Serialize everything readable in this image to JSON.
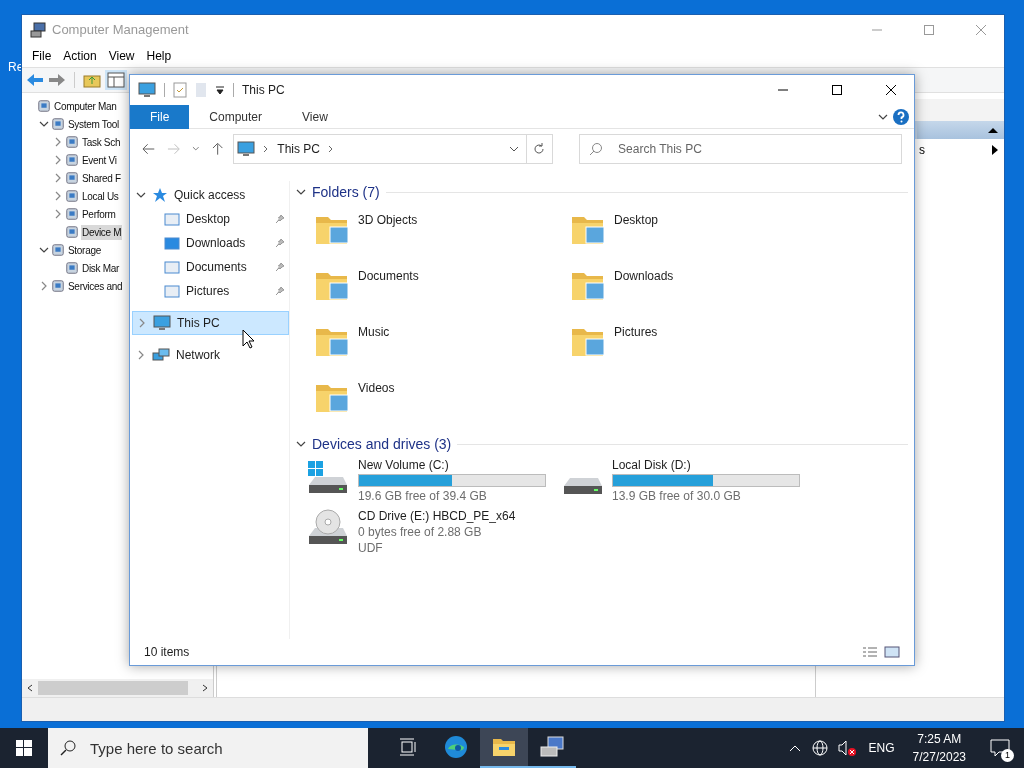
{
  "desktop": {
    "icon_label": "Re"
  },
  "mgmt_window": {
    "title": "Computer Management",
    "menu": [
      "File",
      "Action",
      "View",
      "Help"
    ],
    "tree": [
      {
        "label": "Computer Man",
        "selected": false,
        "children": [
          {
            "label": "System Tool",
            "expanded": true,
            "selected": false,
            "children": [
              {
                "label": "Task Sch",
                "expanded": false,
                "selected": false
              },
              {
                "label": "Event Vi",
                "expanded": false,
                "selected": false
              },
              {
                "label": "Shared F",
                "expanded": false,
                "selected": false
              },
              {
                "label": "Local Us",
                "expanded": false,
                "selected": false
              },
              {
                "label": "Perform",
                "expanded": false,
                "selected": false
              },
              {
                "label": "Device M",
                "selected": true
              }
            ]
          },
          {
            "label": "Storage",
            "expanded": true,
            "selected": false,
            "children": [
              {
                "label": "Disk Mar",
                "selected": false
              }
            ]
          },
          {
            "label": "Services and",
            "expanded": false,
            "selected": false
          }
        ]
      }
    ],
    "actions": {
      "item": "s"
    }
  },
  "explorer": {
    "title": "This PC",
    "ribbon_tabs": [
      {
        "label": "File",
        "selected": true
      },
      {
        "label": "Computer",
        "selected": false
      },
      {
        "label": "View",
        "selected": false
      }
    ],
    "address": "This PC",
    "search": {
      "placeholder": "Search This PC"
    },
    "nav": [
      {
        "label": "Quick access",
        "expanded": true,
        "selected": false,
        "children": [
          {
            "label": "Desktop",
            "pinned": true,
            "selected": false
          },
          {
            "label": "Downloads",
            "pinned": true,
            "selected": false
          },
          {
            "label": "Documents",
            "pinned": true,
            "selected": false
          },
          {
            "label": "Pictures",
            "pinned": true,
            "selected": false
          }
        ]
      },
      {
        "label": "This PC",
        "expanded": false,
        "selected": true
      },
      {
        "label": "Network",
        "expanded": false,
        "selected": false
      }
    ],
    "folders": {
      "title": "Folders (7)",
      "expanded": true,
      "items": [
        {
          "name": "3D Objects"
        },
        {
          "name": "Desktop"
        },
        {
          "name": "Documents"
        },
        {
          "name": "Downloads"
        },
        {
          "name": "Music"
        },
        {
          "name": "Pictures"
        },
        {
          "name": "Videos"
        }
      ]
    },
    "drives": {
      "title": "Devices and drives (3)",
      "expanded": true,
      "items": [
        {
          "kind": "system",
          "name": "New Volume (C:)",
          "level": 0.5,
          "free": "19.6 GB free of 39.4 GB"
        },
        {
          "kind": "disk",
          "name": "Local Disk (D:)",
          "level": 0.54,
          "free": "13.9 GB free of 30.0 GB"
        },
        {
          "kind": "cd",
          "name": "CD Drive (E:) HBCD_PE_x64",
          "free": "0 bytes free of 2.88 GB",
          "fs": "UDF"
        }
      ]
    },
    "status": "10 items"
  },
  "taskbar": {
    "search": {
      "placeholder": "Type here to search"
    },
    "apps": [
      {
        "kind": "taskview",
        "running": false,
        "selected": false
      },
      {
        "kind": "edge",
        "running": false,
        "selected": false
      },
      {
        "kind": "explorer",
        "running": true,
        "selected": true
      },
      {
        "kind": "mmc",
        "running": true,
        "selected": false
      }
    ],
    "language": "ENG",
    "time": "7:25 AM",
    "date": "7/27/2023",
    "notifications": "1"
  }
}
